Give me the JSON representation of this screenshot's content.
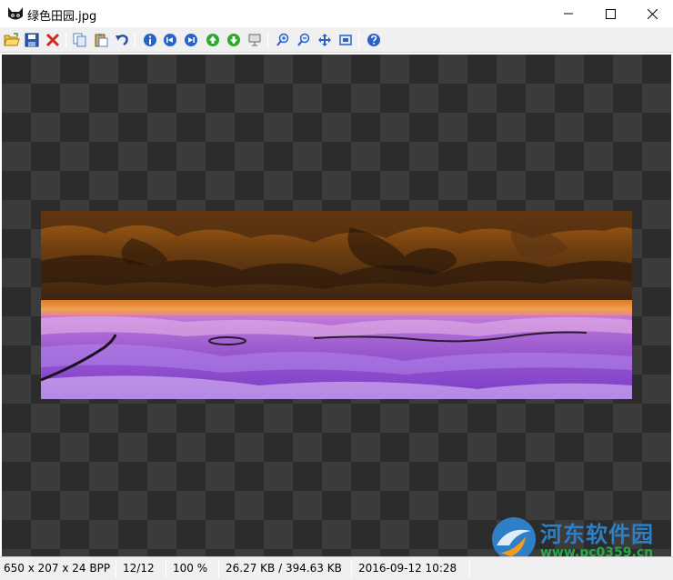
{
  "window": {
    "title": "绿色田园.jpg",
    "app_icon": "cat-face-icon"
  },
  "title_buttons": [
    "minimize-icon",
    "maximize-icon",
    "close-icon"
  ],
  "toolbar": {
    "buttons": [
      {
        "name": "open-folder-icon"
      },
      {
        "name": "save-icon"
      },
      {
        "name": "delete-icon"
      },
      {
        "name": "copy-icon"
      },
      {
        "name": "paste-icon"
      },
      {
        "name": "undo-icon"
      },
      {
        "name": "info-icon"
      },
      {
        "name": "first-image-icon"
      },
      {
        "name": "last-image-icon"
      },
      {
        "name": "previous-image-icon"
      },
      {
        "name": "next-image-icon"
      },
      {
        "name": "slideshow-icon"
      },
      {
        "name": "zoom-in-icon"
      },
      {
        "name": "zoom-out-icon"
      },
      {
        "name": "fit-to-window-icon"
      },
      {
        "name": "actual-size-icon"
      },
      {
        "name": "help-icon"
      }
    ]
  },
  "colors": {
    "canvas_dark": "#2c2c2c",
    "canvas_light": "#3b3b3b",
    "toolbar_bg": "#f0f0f0",
    "watermark_blue": "#2f7fc6",
    "watermark_green": "#2aa84a"
  },
  "watermark": {
    "title": "河东软件园",
    "url": "www.pc0359.cn"
  },
  "statusbar": {
    "dimensions": "650 x 207 x 24 BPP",
    "index": "12/12",
    "zoom": "100 %",
    "size": "26.27 KB / 394.63 KB",
    "datetime": "2016-09-12 10:28"
  }
}
